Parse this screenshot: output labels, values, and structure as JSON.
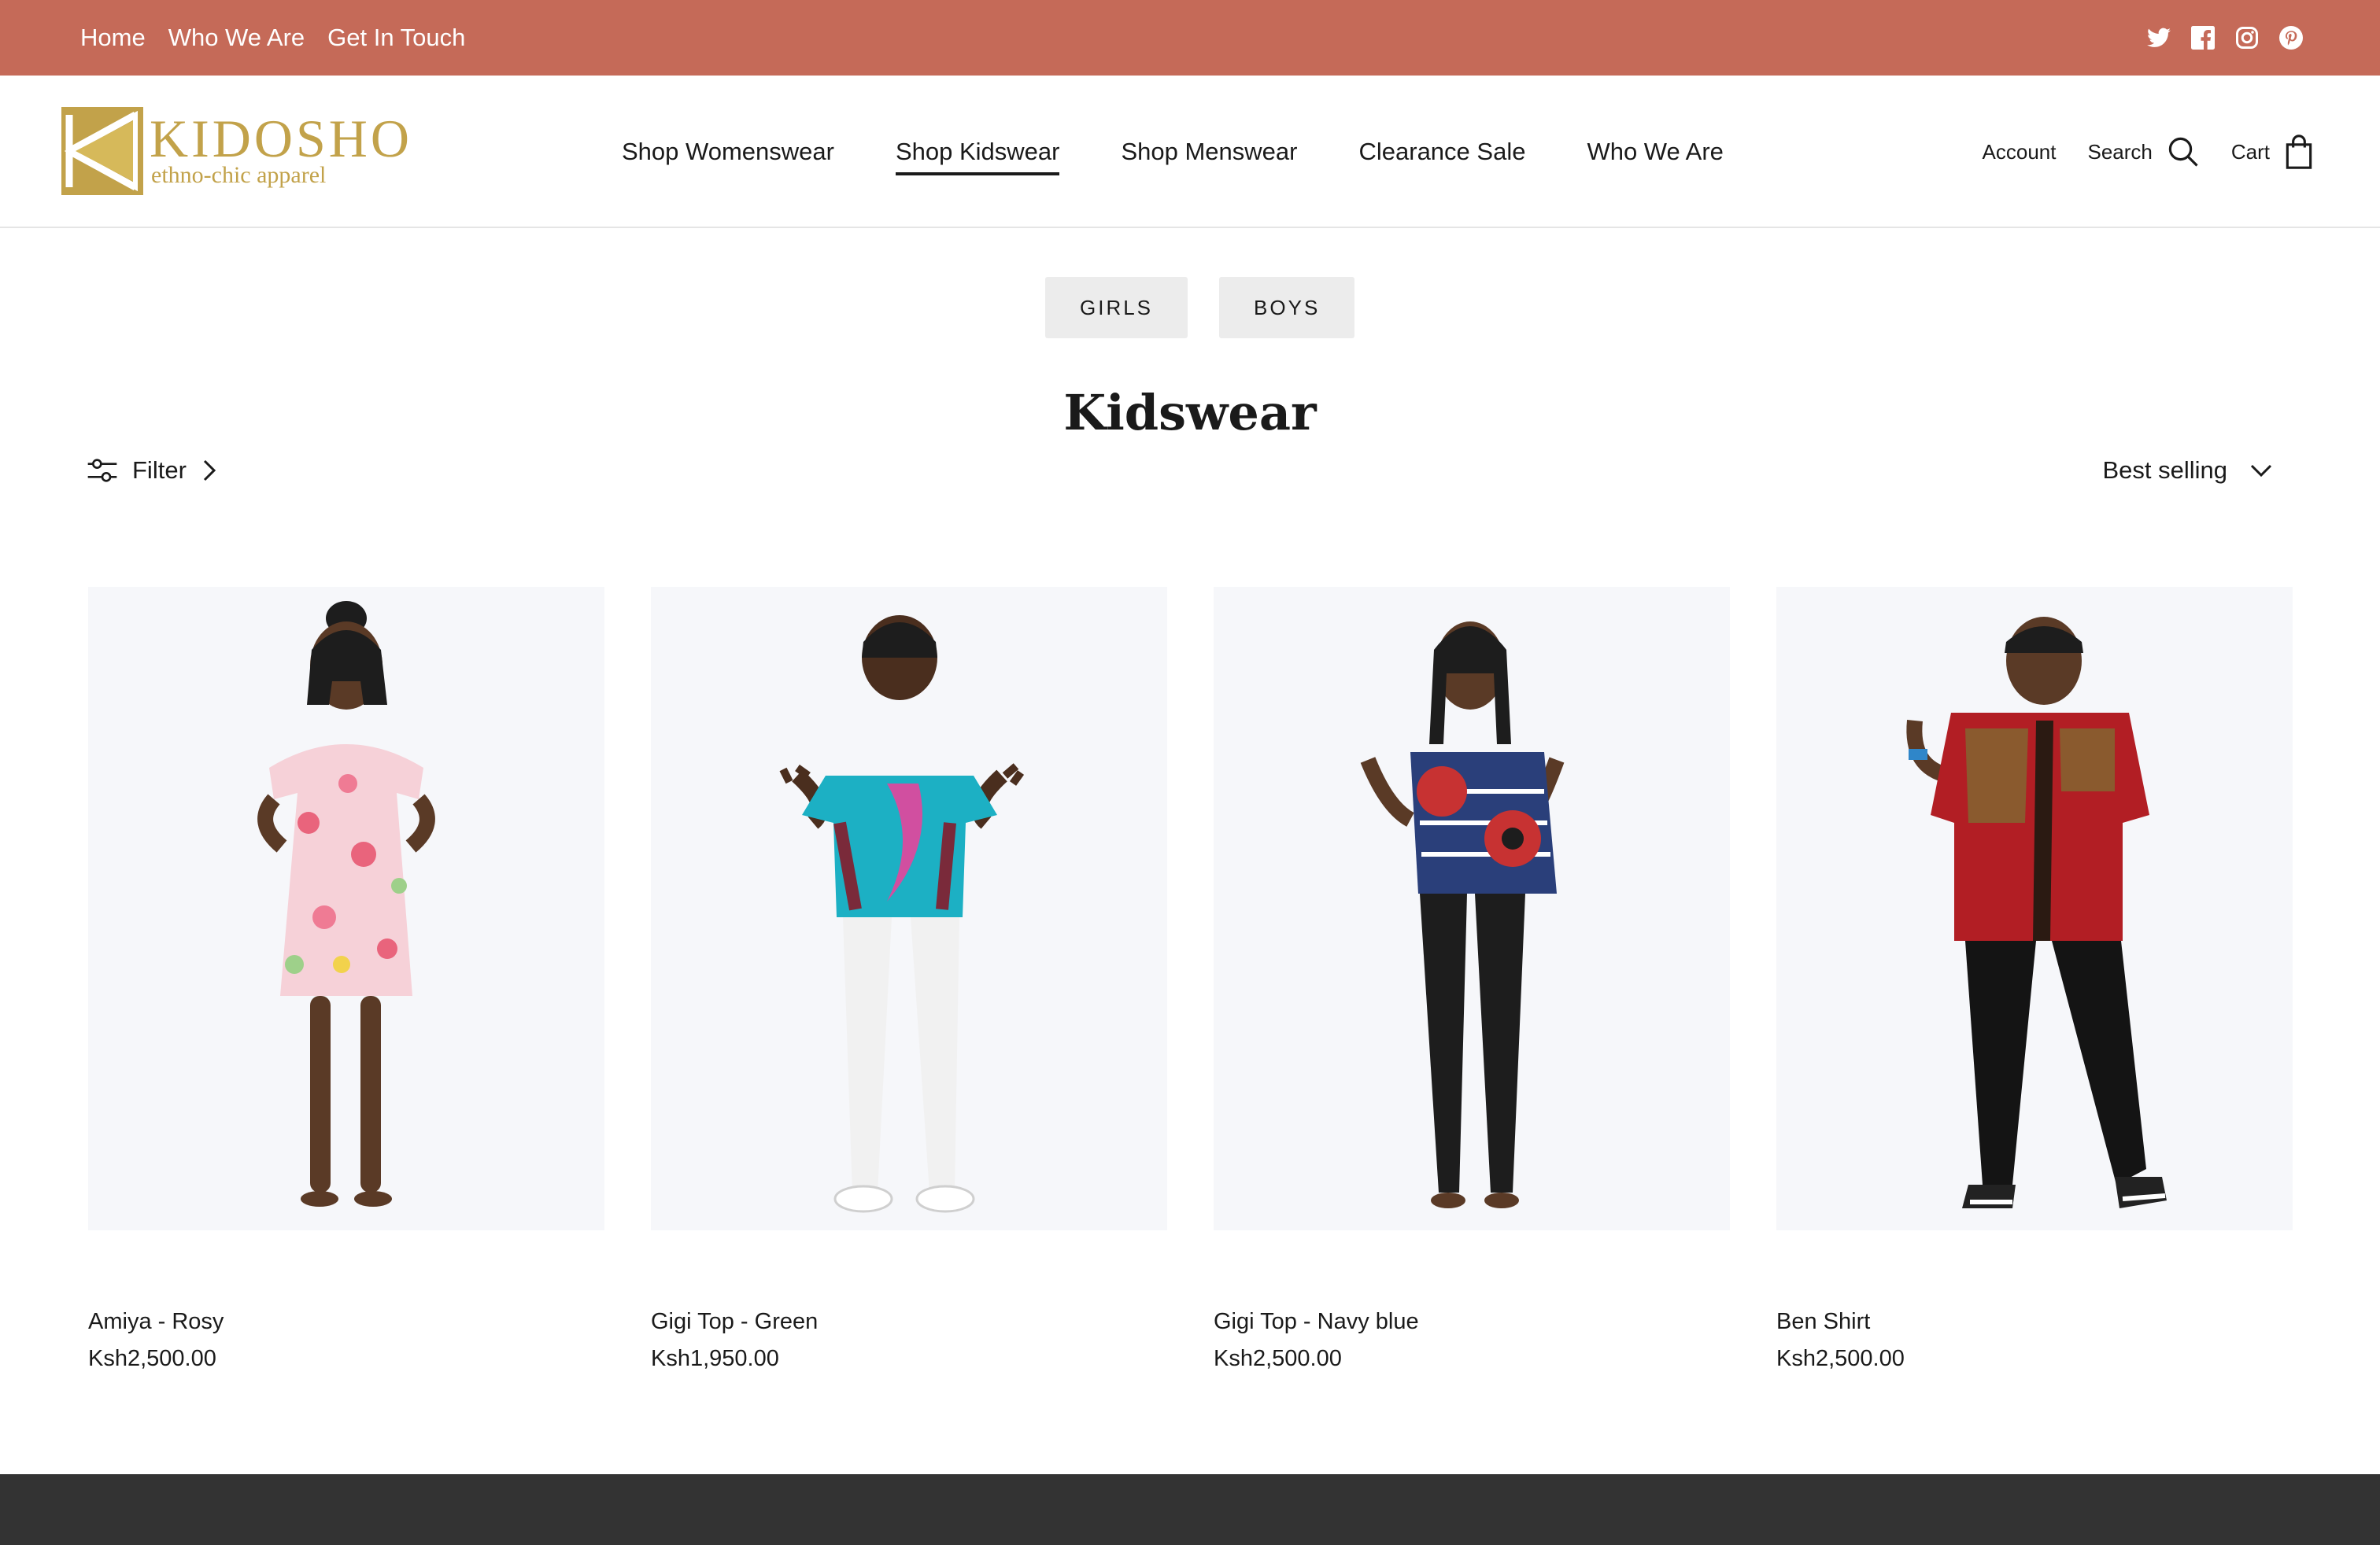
{
  "topbar": {
    "links": [
      "Home",
      "Who We Are",
      "Get In Touch"
    ],
    "social": [
      "twitter-icon",
      "facebook-icon",
      "instagram-icon",
      "pinterest-icon"
    ],
    "bg_color": "#c56a58"
  },
  "brand": {
    "name": "KIDOSHO",
    "tagline": "ethno-chic apparel",
    "color": "#c2a24a"
  },
  "nav": {
    "items": [
      "Shop Womenswear",
      "Shop Kidswear",
      "Shop Menswear",
      "Clearance Sale",
      "Who We Are"
    ],
    "active": "Shop Kidswear"
  },
  "utility": {
    "account": "Account",
    "search": "Search",
    "cart": "Cart"
  },
  "subcategories": [
    "GIRLS",
    "BOYS"
  ],
  "page": {
    "title": "Kidswear",
    "filter_label": "Filter",
    "sort_label": "Best selling"
  },
  "products": [
    {
      "name": "Amiya - Rosy",
      "price": "Ksh2,500.00"
    },
    {
      "name": "Gigi Top - Green",
      "price": "Ksh1,950.00"
    },
    {
      "name": "Gigi Top - Navy blue",
      "price": "Ksh2,500.00"
    },
    {
      "name": "Ben Shirt",
      "price": "Ksh2,500.00"
    }
  ]
}
